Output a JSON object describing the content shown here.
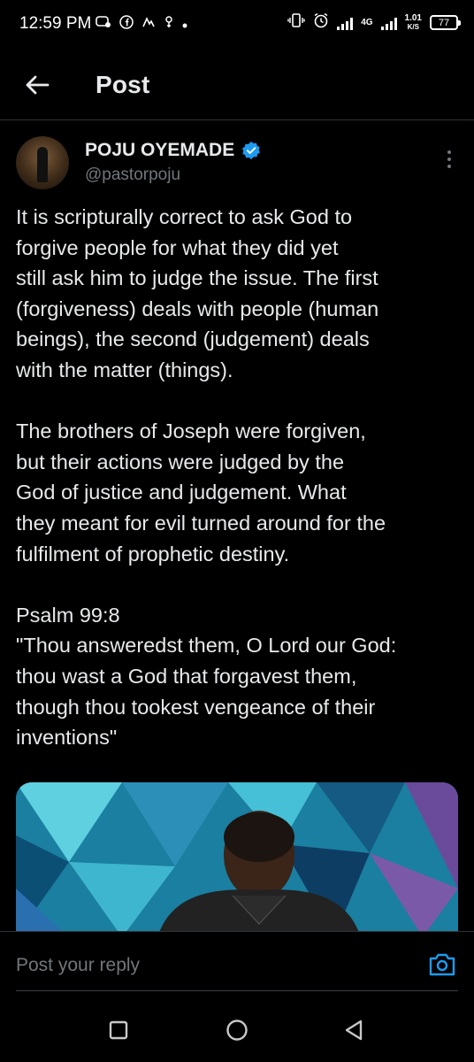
{
  "status_bar": {
    "time": "12:59 PM",
    "network": "4G",
    "speed_value": "1.01",
    "speed_unit": "K/S",
    "battery": "77"
  },
  "header": {
    "title": "Post"
  },
  "post": {
    "author_name": "POJU OYEMADE",
    "author_handle": "@pastorpoju",
    "text": "It is scripturally correct to ask God to\nforgive people for what they did yet\nstill ask him to judge the issue. The first\n(forgiveness) deals with people (human\nbeings), the second (judgement) deals\nwith the matter (things).\n\nThe brothers of Joseph were forgiven,\nbut their actions were judged by the\nGod of justice and judgement. What\nthey meant for evil turned around for the\nfulfilment of prophetic destiny.\n\nPsalm 99:8\n\"Thou answeredst them, O Lord our God:\nthou wast a God that forgavest them,\nthough thou tookest vengeance of their\ninventions\""
  },
  "reply": {
    "placeholder": "Post your reply"
  },
  "colors": {
    "background": "#000000",
    "text": "#e7e9ea",
    "muted": "#71767b",
    "accent": "#1d9bf0"
  }
}
